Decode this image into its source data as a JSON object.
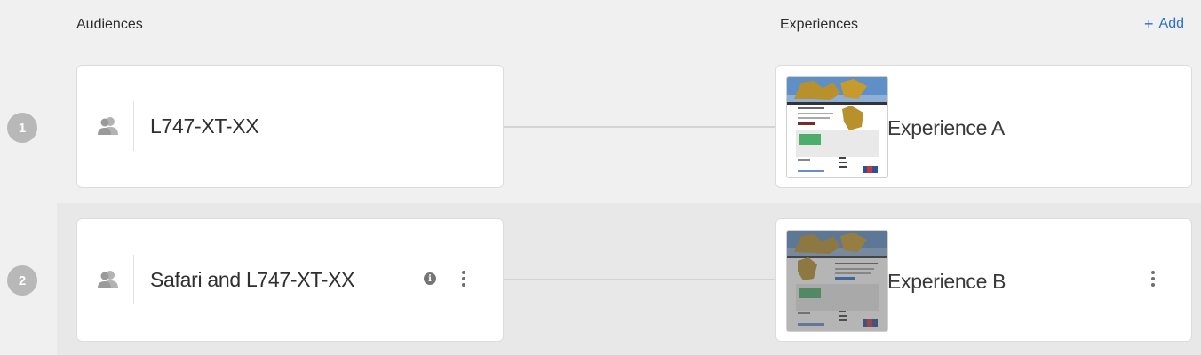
{
  "header": {
    "audiences_label": "Audiences",
    "experiences_label": "Experiences",
    "add_label": "Add",
    "add_icon": "plus-icon"
  },
  "rows": [
    {
      "number": "1",
      "audience": {
        "label": "L747-XT-XX",
        "icon": "audience-icon"
      },
      "experience": {
        "label": "Experience A",
        "thumbnail": "page-thumbnail",
        "selected": false
      }
    },
    {
      "number": "2",
      "audience": {
        "label": "Safari and L747-XT-XX",
        "icon": "audience-icon",
        "info_icon": "info-icon",
        "menu_icon": "more-vertical-icon"
      },
      "experience": {
        "label": "Experience B",
        "thumbnail": "page-thumbnail",
        "selected": true,
        "menu_icon": "more-vertical-icon"
      }
    }
  ],
  "colors": {
    "accent": "#2d6fce",
    "background": "#f0f0f0",
    "badge": "#b8b8b8"
  }
}
